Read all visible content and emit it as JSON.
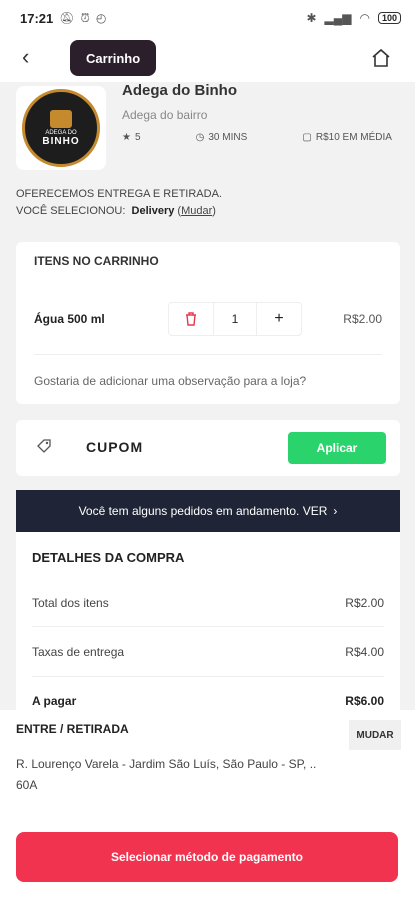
{
  "status_bar": {
    "time": "17:21",
    "battery": "100"
  },
  "header": {
    "title": "Carrinho"
  },
  "store": {
    "name": "Adega do Binho",
    "subtitle": "Adega do bairro",
    "rating": "5",
    "time": "30 MINS",
    "avg_price": "R$10 EM MÉDIA",
    "logo_text_top": "ADEGA DO",
    "logo_text_bottom": "BINHO"
  },
  "delivery": {
    "line1": "OFERECEMOS ENTREGA E RETIRADA.",
    "selected_prefix": "VOCÊ SELECIONOU:",
    "selected_value": "Delivery",
    "change_link": "Mudar"
  },
  "cart": {
    "title": "ITENS NO CARRINHO",
    "items": [
      {
        "name": "Água 500 ml",
        "quantity": "1",
        "price": "R$2.00"
      }
    ],
    "observation_placeholder": "Gostaria de adicionar uma observação para a loja?"
  },
  "coupon": {
    "label": "CUPOM",
    "apply_label": "Aplicar"
  },
  "orders_banner": {
    "text": "Você tem alguns pedidos em andamento. VER"
  },
  "details": {
    "title": "DETALHES DA COMPRA",
    "rows": [
      {
        "label": "Total dos itens",
        "value": "R$2.00"
      },
      {
        "label": "Taxas de entrega",
        "value": "R$4.00"
      },
      {
        "label": "A pagar",
        "value": "R$6.00"
      }
    ]
  },
  "address": {
    "title": "ENTRE / RETIRADA",
    "change_label": "MUDAR",
    "line1": "R. Lourenço Varela - Jardim São Luís, São Paulo - SP, ..",
    "line2": "60A"
  },
  "pay_button": {
    "label": "Selecionar método de pagamento"
  },
  "colors": {
    "accent": "#f2334f",
    "success": "#2bd36c",
    "banner": "#1f2536",
    "title_pill": "#2b1f2b"
  }
}
